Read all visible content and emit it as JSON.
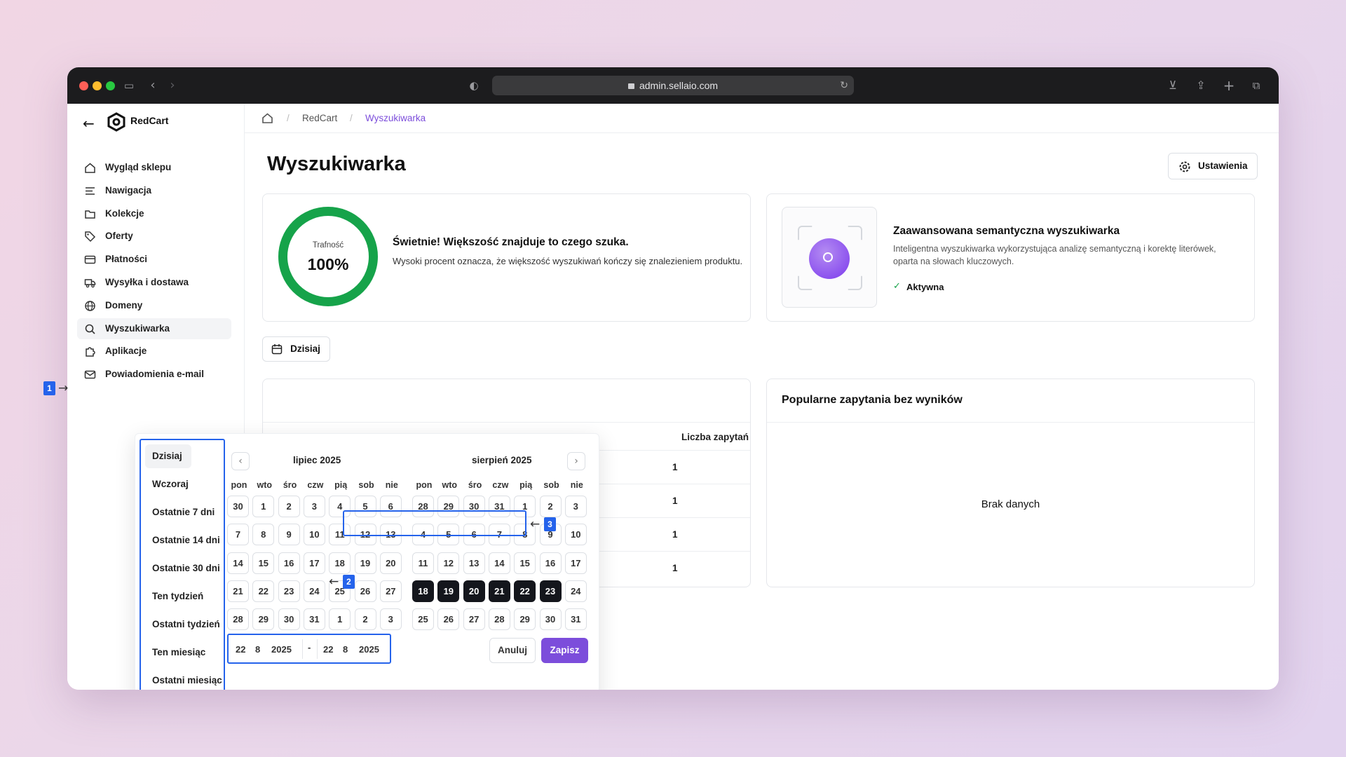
{
  "browser": {
    "url": "admin.sellaio.com"
  },
  "sidebar": {
    "brand": "RedCart",
    "items": [
      {
        "label": "Wygląd sklepu",
        "icon": "home-icon"
      },
      {
        "label": "Nawigacja",
        "icon": "menu-lines-icon"
      },
      {
        "label": "Kolekcje",
        "icon": "folder-icon"
      },
      {
        "label": "Oferty",
        "icon": "tag-icon"
      },
      {
        "label": "Płatności",
        "icon": "credit-card-icon"
      },
      {
        "label": "Wysyłka i dostawa",
        "icon": "truck-icon"
      },
      {
        "label": "Domeny",
        "icon": "globe-icon"
      },
      {
        "label": "Wyszukiwarka",
        "icon": "search-icon"
      },
      {
        "label": "Aplikacje",
        "icon": "puzzle-icon"
      },
      {
        "label": "Powiadomienia e-mail",
        "icon": "mail-icon"
      }
    ],
    "active_index": 7
  },
  "breadcrumb": {
    "items": [
      "RedCart",
      "Wyszukiwarka"
    ]
  },
  "page": {
    "title": "Wyszukiwarka",
    "settings_label": "Ustawienia"
  },
  "accuracy": {
    "label": "Trafność",
    "value": "100%",
    "percent": 100,
    "heading": "Świetnie! Większość znajduje to czego szuka.",
    "description": "Wysoki procent oznacza, że większość wyszukiwań kończy się znalezieniem produktu."
  },
  "semantic": {
    "heading": "Zaawansowana semantyczna wyszukiwarka",
    "description": "Inteligentna wyszukiwarka wykorzystująca analizę semantyczną i korektę literówek, oparta na słowach kluczowych.",
    "status": "Aktywna"
  },
  "date_button": {
    "label": "Dzisiaj"
  },
  "queries_table": {
    "column_count": "Liczba zapytań",
    "values": [
      "1",
      "1",
      "1",
      "1"
    ]
  },
  "no_results": {
    "title": "Popularne zapytania bez wyników",
    "empty": "Brak danych"
  },
  "date_picker": {
    "presets": [
      "Dzisiaj",
      "Wczoraj",
      "Ostatnie 7 dni",
      "Ostatnie 14 dni",
      "Ostatnie 30 dni",
      "Ten tydzień",
      "Ostatni tydzień",
      "Ten miesiąc",
      "Ostatni miesiąc"
    ],
    "selected_preset": "Dzisiaj",
    "weekdays": [
      "pon",
      "wto",
      "śro",
      "czw",
      "pią",
      "sob",
      "nie"
    ],
    "months": [
      {
        "title": "lipiec 2025",
        "days": [
          30,
          1,
          2,
          3,
          4,
          5,
          6,
          7,
          8,
          9,
          10,
          11,
          12,
          13,
          14,
          15,
          16,
          17,
          18,
          19,
          20,
          21,
          22,
          23,
          24,
          25,
          26,
          27,
          28,
          29,
          30,
          31,
          1,
          2,
          3
        ],
        "selected": []
      },
      {
        "title": "sierpień 2025",
        "days": [
          28,
          29,
          30,
          31,
          1,
          2,
          3,
          4,
          5,
          6,
          7,
          8,
          9,
          10,
          11,
          12,
          13,
          14,
          15,
          16,
          17,
          18,
          19,
          20,
          21,
          22,
          23,
          24,
          25,
          26,
          27,
          28,
          29,
          30,
          31
        ],
        "selected": [
          21,
          22,
          23,
          24,
          25,
          26
        ]
      }
    ],
    "from": {
      "day": "22",
      "month": "8",
      "year": "2025"
    },
    "separator": "-",
    "to": {
      "day": "22",
      "month": "8",
      "year": "2025"
    },
    "cancel_label": "Anuluj",
    "save_label": "Zapisz",
    "accent": "#7c4ddb"
  },
  "annotations": [
    "1",
    "2",
    "3"
  ]
}
